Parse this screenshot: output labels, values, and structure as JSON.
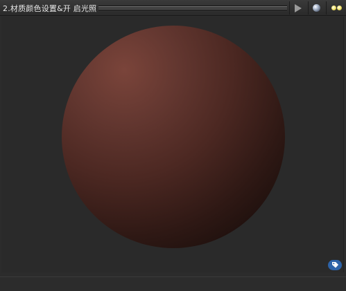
{
  "window": {
    "title": "2.材质颜色设置&开 启光照"
  },
  "toolbar": {
    "buttons": [
      {
        "icon": "play-icon"
      },
      {
        "icon": "sphere-preview-icon"
      },
      {
        "icon": "lights-toggle-icon"
      }
    ]
  },
  "viewport": {
    "preview_object": "sphere",
    "sphere_color": "#5a2f28",
    "background_color": "#2a2a2a"
  },
  "footer": {
    "tag_icon": "tag-icon",
    "tag_color": "#2d63a8"
  }
}
